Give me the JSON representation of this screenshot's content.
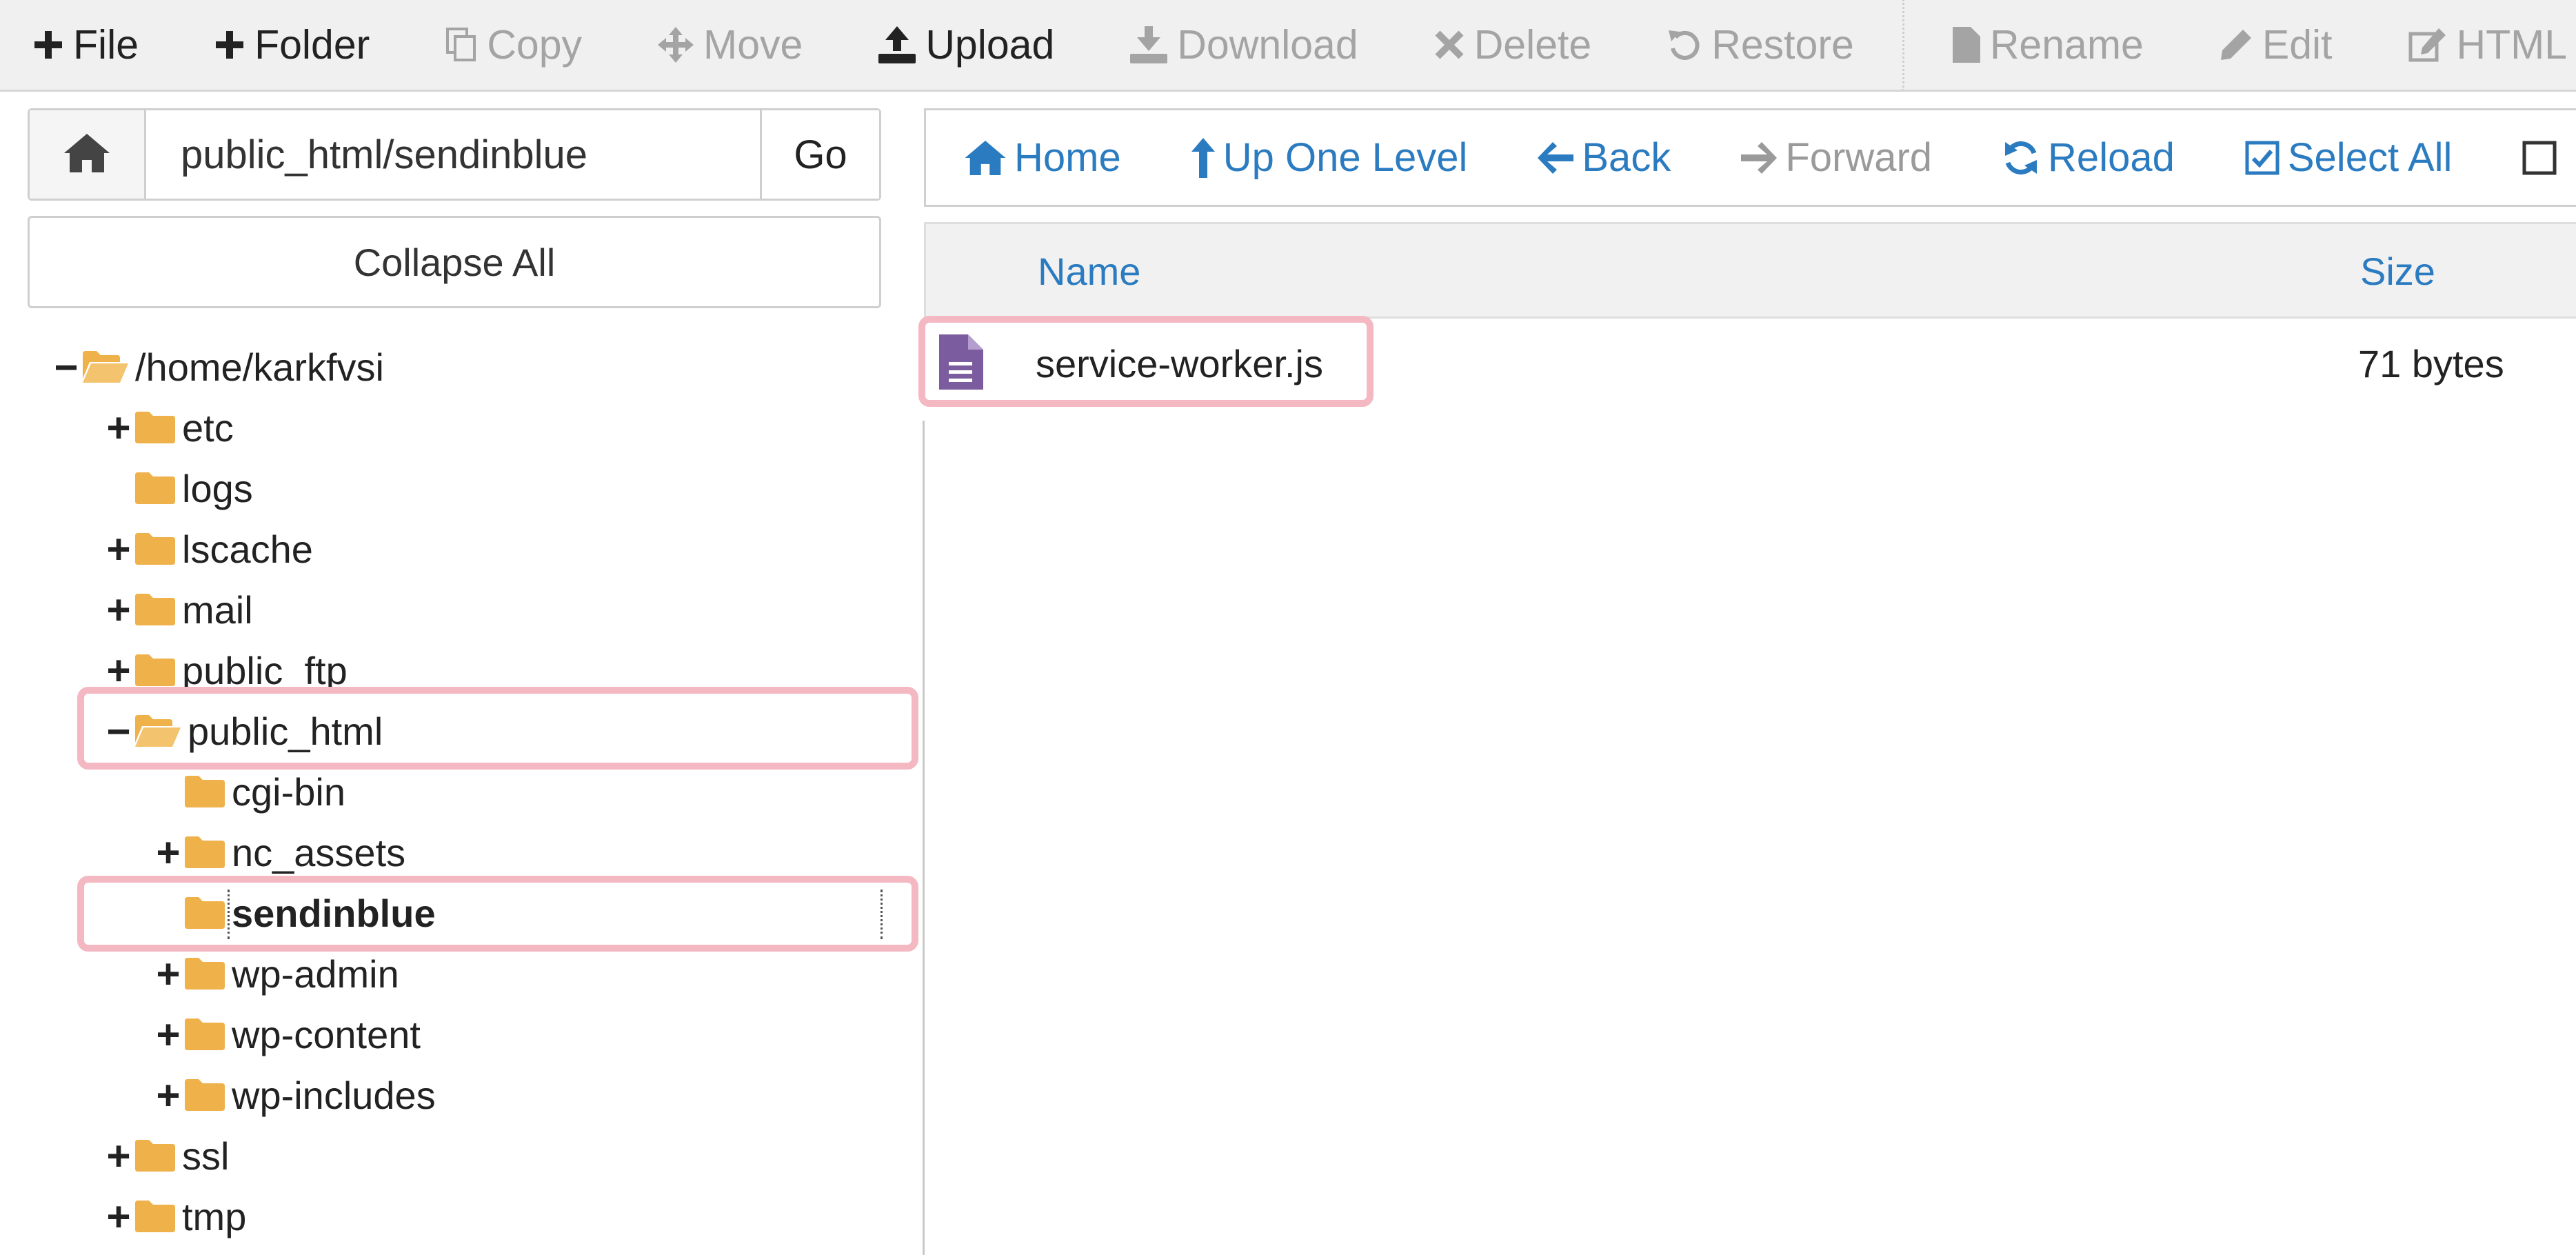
{
  "toolbar": {
    "buttons": [
      {
        "label": "File",
        "icon": "plus-icon",
        "enabled": true
      },
      {
        "label": "Folder",
        "icon": "plus-icon",
        "enabled": true
      },
      {
        "label": "Copy",
        "icon": "copy-icon",
        "enabled": false
      },
      {
        "label": "Move",
        "icon": "move-icon",
        "enabled": false
      },
      {
        "label": "Upload",
        "icon": "upload-icon",
        "enabled": true
      },
      {
        "label": "Download",
        "icon": "download-icon",
        "enabled": false
      },
      {
        "label": "Delete",
        "icon": "close-icon",
        "enabled": false
      },
      {
        "label": "Restore",
        "icon": "undo-icon",
        "enabled": false
      },
      {
        "label": "Rename",
        "icon": "file-icon",
        "enabled": false
      },
      {
        "label": "Edit",
        "icon": "pencil-icon",
        "enabled": false
      },
      {
        "label": "HTML E",
        "icon": "edit-square-icon",
        "enabled": false
      }
    ]
  },
  "path_bar": {
    "value": "public_html/sendinblue",
    "go_label": "Go"
  },
  "collapse_label": "Collapse All",
  "tree": [
    {
      "label": "/home/karkfvsi",
      "toggle": "−",
      "open": true
    },
    {
      "label": "etc",
      "toggle": "+"
    },
    {
      "label": "logs",
      "toggle": ""
    },
    {
      "label": "lscache",
      "toggle": "+"
    },
    {
      "label": "mail",
      "toggle": "+"
    },
    {
      "label": "public_ftp",
      "toggle": "+"
    },
    {
      "label": "public_html",
      "toggle": "−",
      "open": true
    },
    {
      "label": "cgi-bin",
      "toggle": ""
    },
    {
      "label": "nc_assets",
      "toggle": "+"
    },
    {
      "label": "sendinblue",
      "toggle": "",
      "selected": true
    },
    {
      "label": "wp-admin",
      "toggle": "+"
    },
    {
      "label": "wp-content",
      "toggle": "+"
    },
    {
      "label": "wp-includes",
      "toggle": "+"
    },
    {
      "label": "ssl",
      "toggle": "+"
    },
    {
      "label": "tmp",
      "toggle": "+"
    }
  ],
  "nav": {
    "home": "Home",
    "up": "Up One Level",
    "back": "Back",
    "forward": "Forward",
    "reload": "Reload",
    "select_all": "Select All"
  },
  "list": {
    "col_name": "Name",
    "col_size": "Size",
    "files": [
      {
        "name": "service-worker.js",
        "size": "71 bytes",
        "icon": "text-file-icon"
      }
    ]
  },
  "colors": {
    "link_blue": "#2b7bc0",
    "folder_yellow": "#efb14a",
    "highlight_pink": "#f3b8c1",
    "file_purple": "#7b5c9e"
  }
}
